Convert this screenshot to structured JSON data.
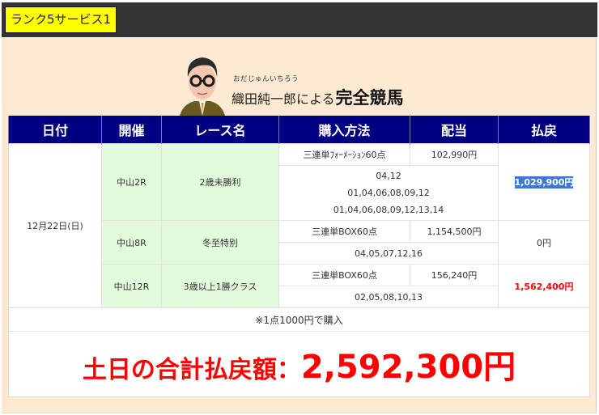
{
  "topbar": {
    "badge_label": "ランク5サービス1"
  },
  "hero": {
    "ruby": "おだじゅんいちろう",
    "name": "織田純一郎による",
    "title": "完全競馬",
    "avatar_icon": "caricature-man-glasses-icon"
  },
  "table": {
    "headers": [
      "日付",
      "開催",
      "レース名",
      "購入方法",
      "配当",
      "払戻"
    ],
    "date": "12月22日(日)",
    "races": [
      {
        "venue": "中山2R",
        "race_name": "2歳未勝利",
        "method": "三連単ﾌｫｰﾒｰｼｮﾝ60点",
        "dividend": "102,990円",
        "combinations": [
          "04,12",
          "01,04,06,08,09,12",
          "01,04,06,08,09,12,13,14"
        ],
        "payout": "1,029,900円"
      },
      {
        "venue": "中山8R",
        "race_name": "冬至特別",
        "method": "三連単BOX60点",
        "dividend": "1,154,500円",
        "combinations": [
          "04,05,07,12,16"
        ],
        "payout": "0円"
      },
      {
        "venue": "中山12R",
        "race_name": "3歳以上1勝クラス",
        "method": "三連単BOX60点",
        "dividend": "156,240円",
        "combinations": [
          "02,05,08,10,13"
        ],
        "payout": "1,562,400円"
      }
    ],
    "note": "※1点1000円で購入",
    "total_label": "土日の合計払戻額：",
    "total_value": "2,592,300円"
  },
  "colors": {
    "header_bg": "#000080",
    "badge_bg": "#ffff00",
    "panel_bg": "#feead3",
    "venue_bg": "#e1fbdc",
    "payout_red": "#ff0000",
    "selection": "#3a78d4"
  }
}
